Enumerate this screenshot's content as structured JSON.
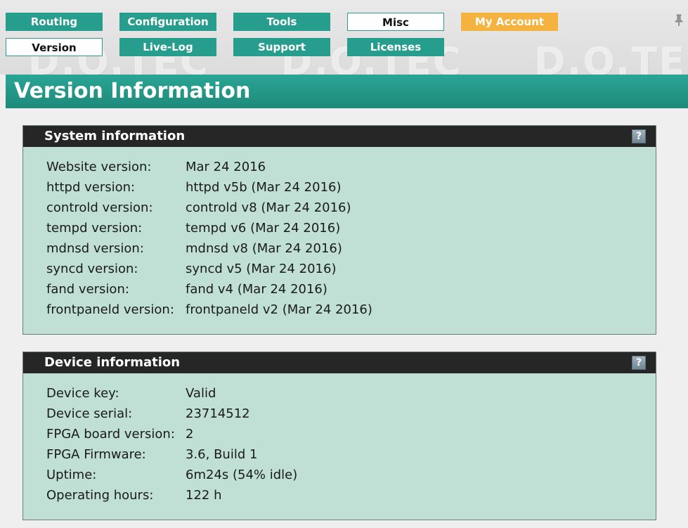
{
  "nav": {
    "row1": [
      {
        "id": "routing",
        "label": "Routing",
        "style": "teal"
      },
      {
        "id": "configuration",
        "label": "Configuration",
        "style": "teal"
      },
      {
        "id": "tools",
        "label": "Tools",
        "style": "teal"
      },
      {
        "id": "misc",
        "label": "Misc",
        "style": "white"
      },
      {
        "id": "my-account",
        "label": "My Account",
        "style": "orange"
      }
    ],
    "row2": [
      {
        "id": "version",
        "label": "Version",
        "style": "white"
      },
      {
        "id": "live-log",
        "label": "Live-Log",
        "style": "teal"
      },
      {
        "id": "support",
        "label": "Support",
        "style": "teal"
      },
      {
        "id": "licenses",
        "label": "Licenses",
        "style": "teal"
      }
    ],
    "watermark": "D.O.TEC",
    "pin_icon": "pin-icon"
  },
  "page": {
    "title": "Version Information"
  },
  "system": {
    "header": "System information",
    "help_label": "?",
    "rows": [
      {
        "label": "Website version:",
        "value": "Mar 24 2016"
      },
      {
        "label": "httpd version:",
        "value": "httpd v5b (Mar 24 2016)"
      },
      {
        "label": "controld version:",
        "value": "controld v8 (Mar 24 2016)"
      },
      {
        "label": "tempd version:",
        "value": "tempd v6 (Mar 24 2016)"
      },
      {
        "label": "mdnsd version:",
        "value": "mdnsd v8 (Mar 24 2016)"
      },
      {
        "label": "syncd version:",
        "value": "syncd v5 (Mar 24 2016)"
      },
      {
        "label": "fand version:",
        "value": "fand v4 (Mar 24 2016)"
      },
      {
        "label": "frontpaneld version:",
        "value": "frontpaneld v2 (Mar 24 2016)"
      }
    ]
  },
  "device": {
    "header": "Device information",
    "help_label": "?",
    "rows": [
      {
        "label": "Device key:",
        "value": "Valid"
      },
      {
        "label": "Device serial:",
        "value": "23714512"
      },
      {
        "label": "FPGA board version:",
        "value": "2"
      },
      {
        "label": "FPGA Firmware:",
        "value": "3.6, Build 1"
      },
      {
        "label": "Uptime:",
        "value": "6m24s (54% idle)"
      },
      {
        "label": "Operating hours:",
        "value": "122 h"
      }
    ]
  },
  "colors": {
    "teal": "#279e8d",
    "orange": "#f4b23f",
    "panel_bg": "#c0e0d5",
    "panel_header": "#262626"
  }
}
